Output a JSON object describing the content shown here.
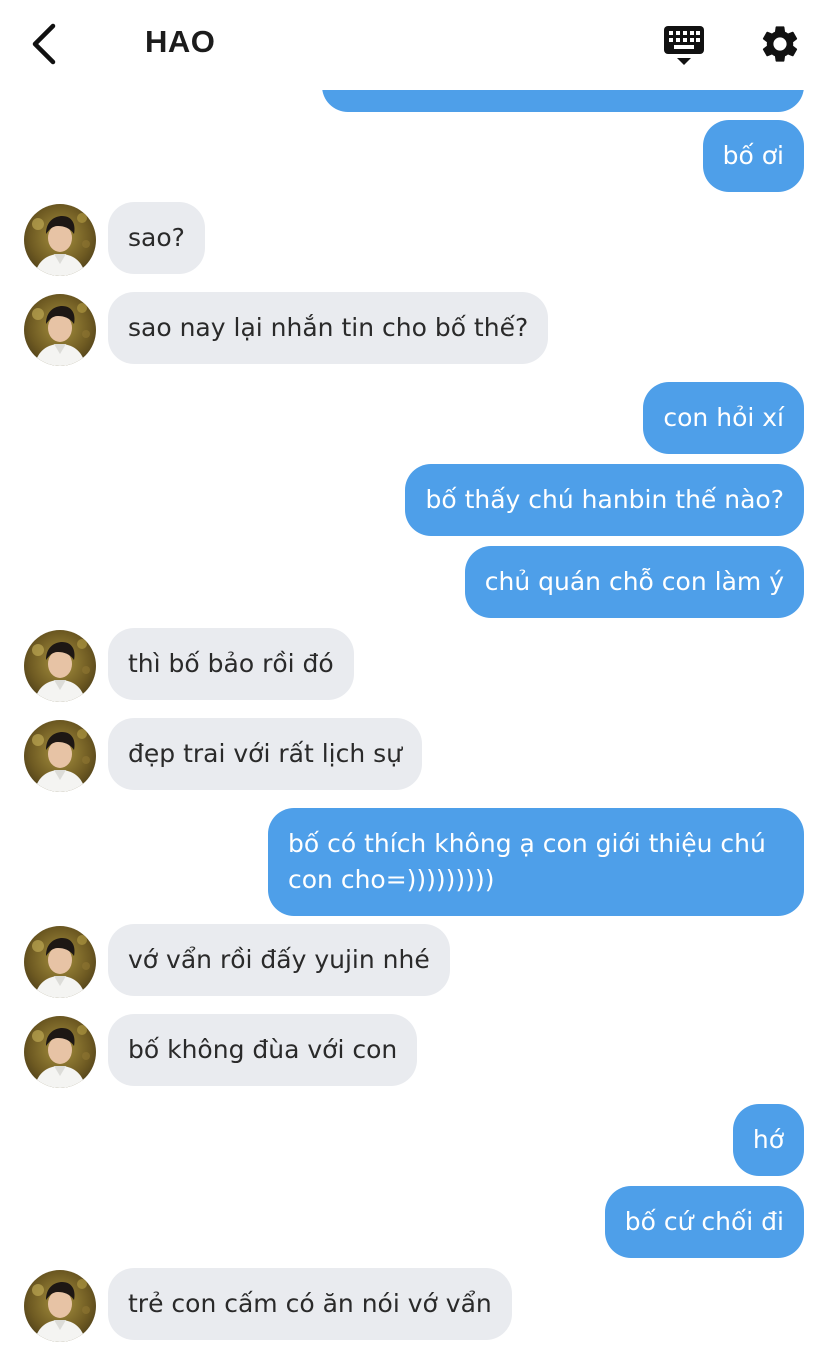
{
  "header": {
    "title": "HAO",
    "back_icon": "chevron-left-icon",
    "keyboard_icon": "keyboard-icon",
    "settings_icon": "gear-icon"
  },
  "colors": {
    "outgoing_bubble": "#4e9fe9",
    "incoming_bubble": "#e9ebef",
    "incoming_text": "#2a2a2a"
  },
  "messages": [
    {
      "side": "out",
      "text": ""
    },
    {
      "side": "out",
      "text": "bố ơi"
    },
    {
      "side": "in",
      "text": "sao?"
    },
    {
      "side": "in",
      "text": "sao nay lại nhắn tin cho bố thế?"
    },
    {
      "side": "out",
      "text": "con hỏi xí"
    },
    {
      "side": "out",
      "text": "bố thấy chú hanbin thế nào?"
    },
    {
      "side": "out",
      "text": "chủ quán chỗ con làm ý"
    },
    {
      "side": "in",
      "text": "thì bố bảo rồi đó"
    },
    {
      "side": "in",
      "text": "đẹp trai với rất lịch sự"
    },
    {
      "side": "out",
      "text": "bố có thích không ạ con giới thiệu chú con cho=)))))))))"
    },
    {
      "side": "in",
      "text": "vớ vẩn rồi đấy yujin nhé"
    },
    {
      "side": "in",
      "text": "bố không đùa với con"
    },
    {
      "side": "out",
      "text": "hớ"
    },
    {
      "side": "out",
      "text": "bố cứ chối đi"
    },
    {
      "side": "in",
      "text": "trẻ con cấm có ăn nói vớ vẩn"
    }
  ]
}
